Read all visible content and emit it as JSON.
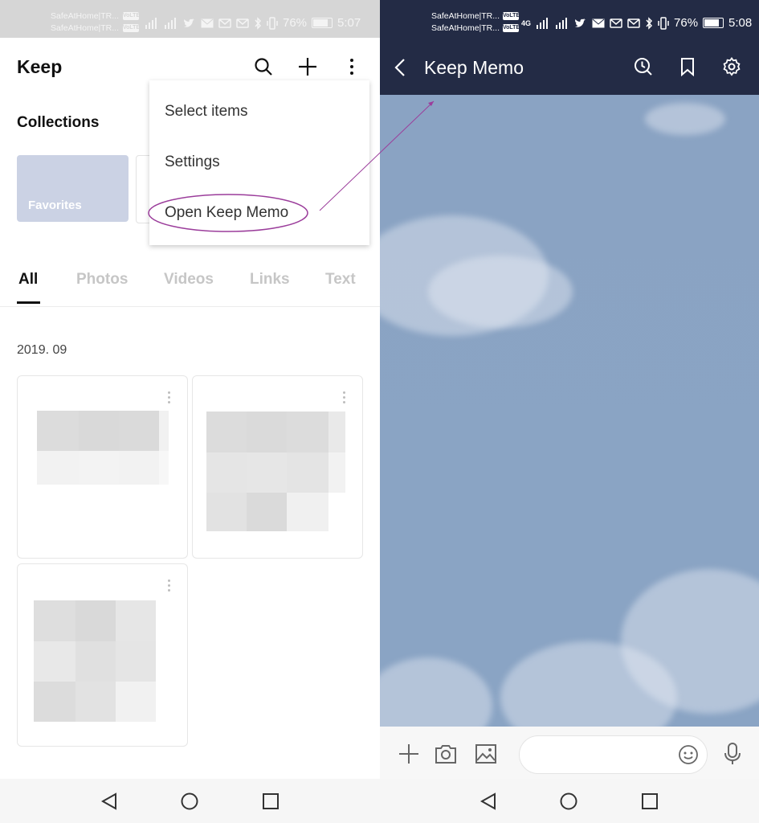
{
  "left": {
    "status": {
      "carrier1": "SafeAtHome|TR...",
      "carrier2": "SafeAtHome|TR...",
      "volte": "VoLTE",
      "battery": "76%",
      "time": "5:07"
    },
    "app_title": "Keep",
    "collections_title": "Collections",
    "favorites_label": "Favorites",
    "menu": {
      "items": [
        "Select items",
        "Settings",
        "Open Keep Memo"
      ]
    },
    "tabs": [
      "All",
      "Photos",
      "Videos",
      "Links",
      "Text"
    ],
    "date_label": "2019. 09"
  },
  "right": {
    "status": {
      "carrier1": "SafeAtHome|TR...",
      "carrier2": "SafeAtHome|TR...",
      "volte": "VoLTE",
      "network": "4G",
      "battery": "76%",
      "time": "5:08"
    },
    "title": "Keep Memo"
  },
  "colors": {
    "left_header": "#d6d6d6",
    "right_header": "#232b45",
    "chat_background": "#849fc0",
    "favorites_card": "#cbd2e4",
    "annotation": "#9b3d9b"
  },
  "icons": {
    "left_toolbar": [
      "search-icon",
      "plus-icon",
      "more-vert-icon"
    ],
    "right_toolbar": [
      "back-icon",
      "history-icon",
      "bookmark-icon",
      "settings-icon"
    ],
    "input_bar": [
      "plus-icon",
      "camera-icon",
      "image-icon",
      "emoji-icon",
      "mic-icon"
    ],
    "nav": [
      "back-triangle-icon",
      "home-circle-icon",
      "recents-square-icon"
    ]
  }
}
